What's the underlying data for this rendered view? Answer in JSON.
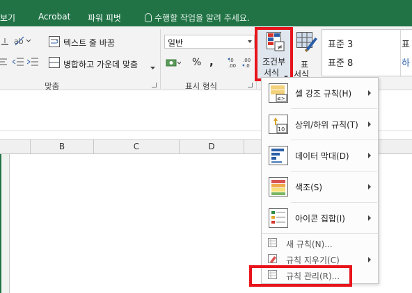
{
  "tabs": {
    "view": "보기",
    "acrobat": "Acrobat",
    "pivot": "파워 피벗",
    "tell_me": "수행할 작업을 알려 주세요."
  },
  "alignment": {
    "wrap_text": "텍스트 줄 바꿈",
    "merge_center": "병합하고 가운데 맞춤",
    "group_label": "맞춤"
  },
  "number": {
    "format_value": "일반",
    "percent": "%",
    "comma": ",",
    "inc_decimal": "←.0\n.00",
    "dec_decimal": ".00\n→.0",
    "group_label": "표시 형식"
  },
  "styles": {
    "conditional_line1": "조건부",
    "conditional_line2": "서식",
    "table_line1": "표",
    "table_line2": "서식",
    "style1": "표준 3",
    "style2": "표준 8",
    "style1_partial": "표",
    "style2_partial": "하"
  },
  "columns": [
    "B",
    "C",
    "D"
  ],
  "menu": {
    "highlight_rules": "셀 강조 규칙(H)",
    "top_bottom_rules": "상위/하위 규칙(T)",
    "data_bars": "데이터 막대(D)",
    "color_scales": "색조(S)",
    "icon_sets": "아이콘 집합(I)",
    "new_rule": "새 규칙(N)...",
    "clear_rules": "규칙 지우기(C)",
    "manage_rules": "규칙 관리(R)...",
    "top_bottom_icon_label": "10"
  },
  "colors": {
    "excel_green": "#217346",
    "highlight_red": "#e8141c"
  }
}
